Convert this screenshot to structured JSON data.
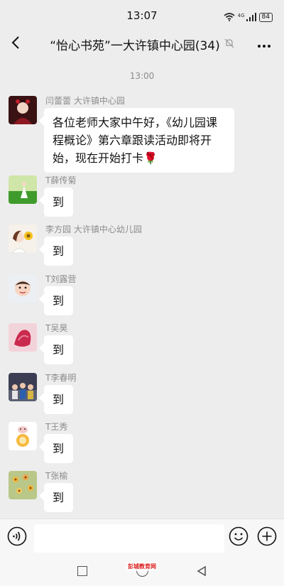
{
  "status_bar": {
    "time": "13:07",
    "network": "4G",
    "battery": "84"
  },
  "header": {
    "title": "“怡心书苑”一大许镇中心园(34)"
  },
  "timestamp": "13:00",
  "messages": [
    {
      "sender": "闫蕾蕾  大许镇中心园",
      "text": "各位老师大家中午好，《幼儿园课程概论》第六章跟读活动即将开始，现在开始打卡🌹"
    },
    {
      "sender": "T薛传菊",
      "text": "到"
    },
    {
      "sender": "李方园 大许镇中心幼儿园",
      "text": "到"
    },
    {
      "sender": "T刘露营",
      "text": "到"
    },
    {
      "sender": "T吴昊",
      "text": "到"
    },
    {
      "sender": "T李春明",
      "text": "到"
    },
    {
      "sender": "T王秀",
      "text": "到"
    },
    {
      "sender": "T张榆",
      "text": "到"
    }
  ],
  "input": {
    "placeholder": ""
  },
  "watermark": "彭城教育网",
  "colors": {
    "background": "#ededed",
    "bubble": "#ffffff",
    "meta_text": "#8c8c8c"
  }
}
